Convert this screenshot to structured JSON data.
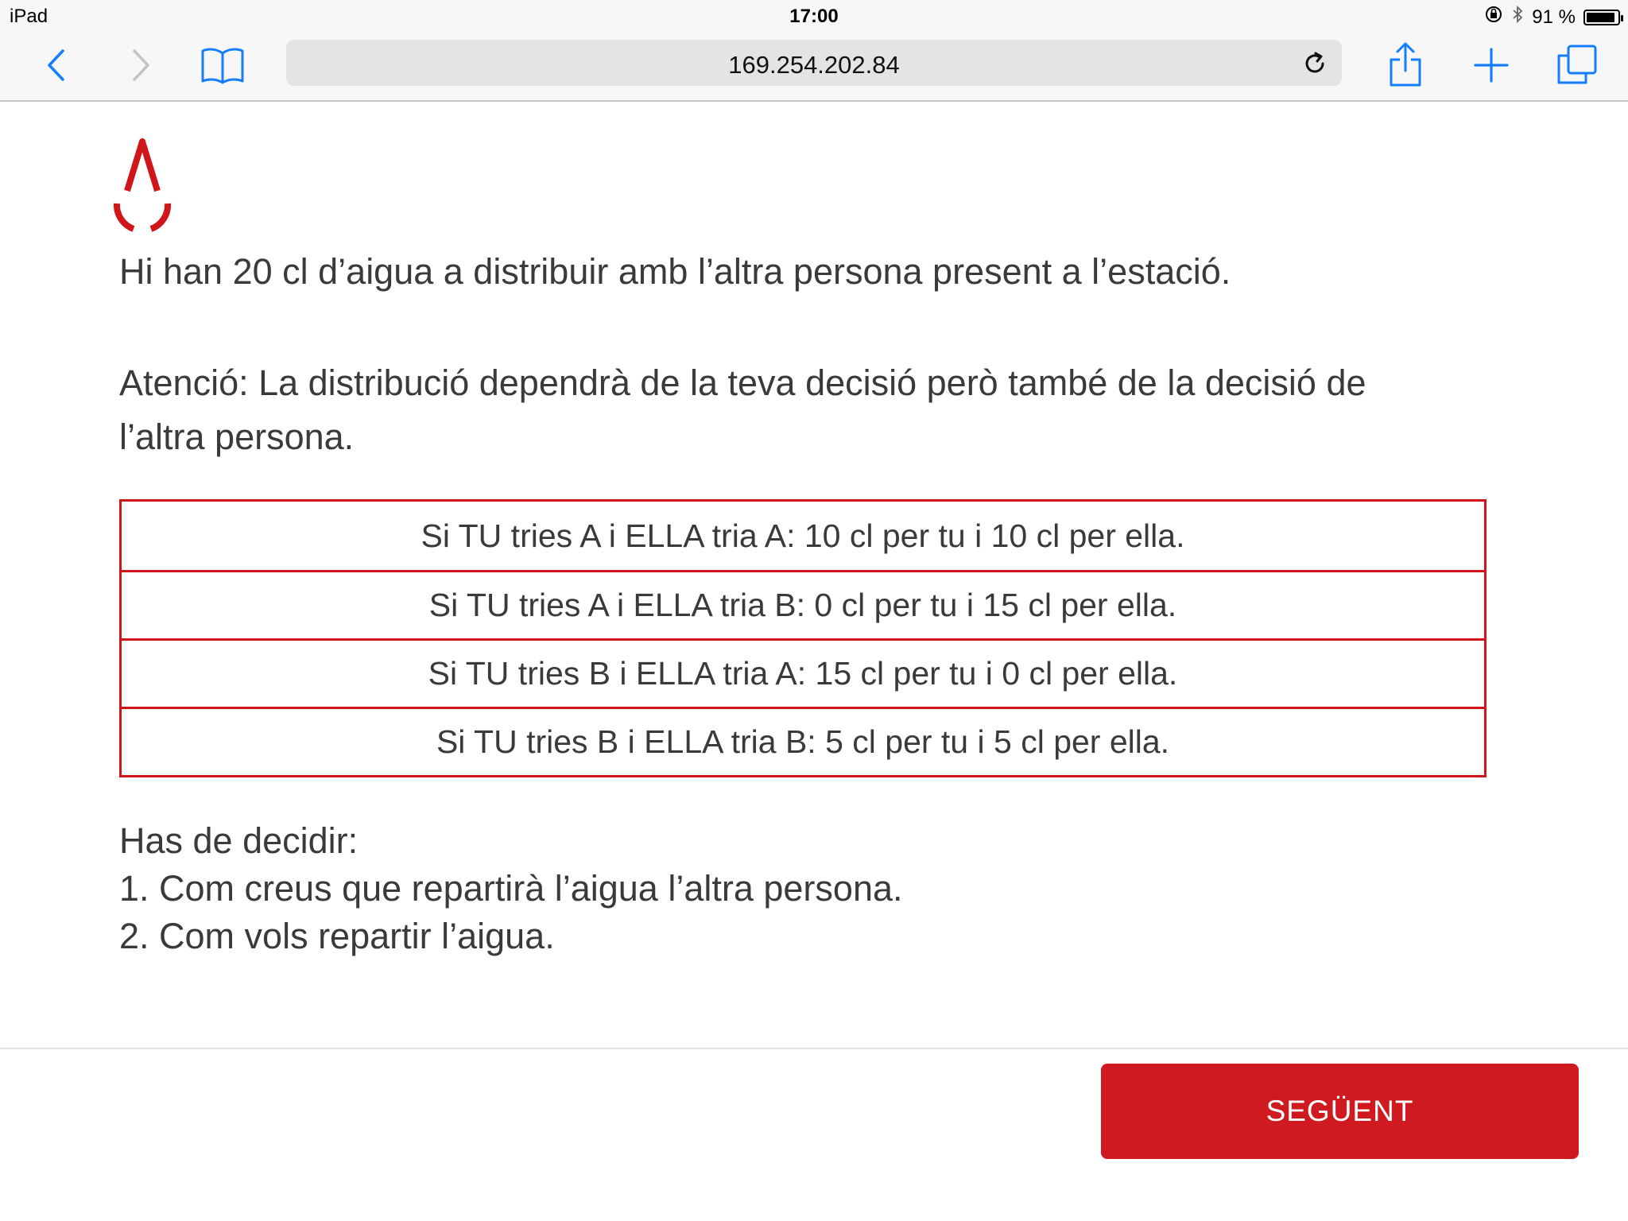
{
  "status_bar": {
    "device": "iPad",
    "time": "17:00",
    "battery": "91 %",
    "battery_level": 0.91
  },
  "browser": {
    "url": "169.254.202.84",
    "icons": {
      "back": "chevron-left-icon",
      "forward": "chevron-right-icon",
      "bookmarks": "open-book-icon",
      "reload": "reload-icon",
      "share": "share-icon",
      "new_tab": "plus-icon",
      "tabs": "tabs-icon"
    }
  },
  "content": {
    "logo_icon": "water-drop-icon",
    "intro": "Hi han 20 cl d’aigua a distribuir amb l’altra persona present a l’estació.",
    "attention_line1": "Atenció: La distribució dependrà de la teva decisió però també de la decisió de",
    "attention_line2": "l’altra persona.",
    "payoffs": [
      "Si TU tries A i ELLA tria A: 10 cl per tu i 10 cl per ella.",
      "Si TU tries A i ELLA tria B: 0 cl per tu i 15 cl per ella.",
      "Si TU tries B i ELLA tria A: 15 cl per tu i 0 cl per ella.",
      "Si TU tries B i ELLA tria B: 5 cl per tu i 5 cl per ella."
    ],
    "decide_heading": "Has de decidir:",
    "decide_items": [
      "1. Com creus que repartirà l’aigua l’altra persona.",
      "2. Com vols repartir l’aigua."
    ]
  },
  "footer": {
    "next_label": "SEGÜENT"
  },
  "colors": {
    "accent_red": "#cf1b1f",
    "ios_blue": "#157efb",
    "text": "#3a3a3a"
  }
}
